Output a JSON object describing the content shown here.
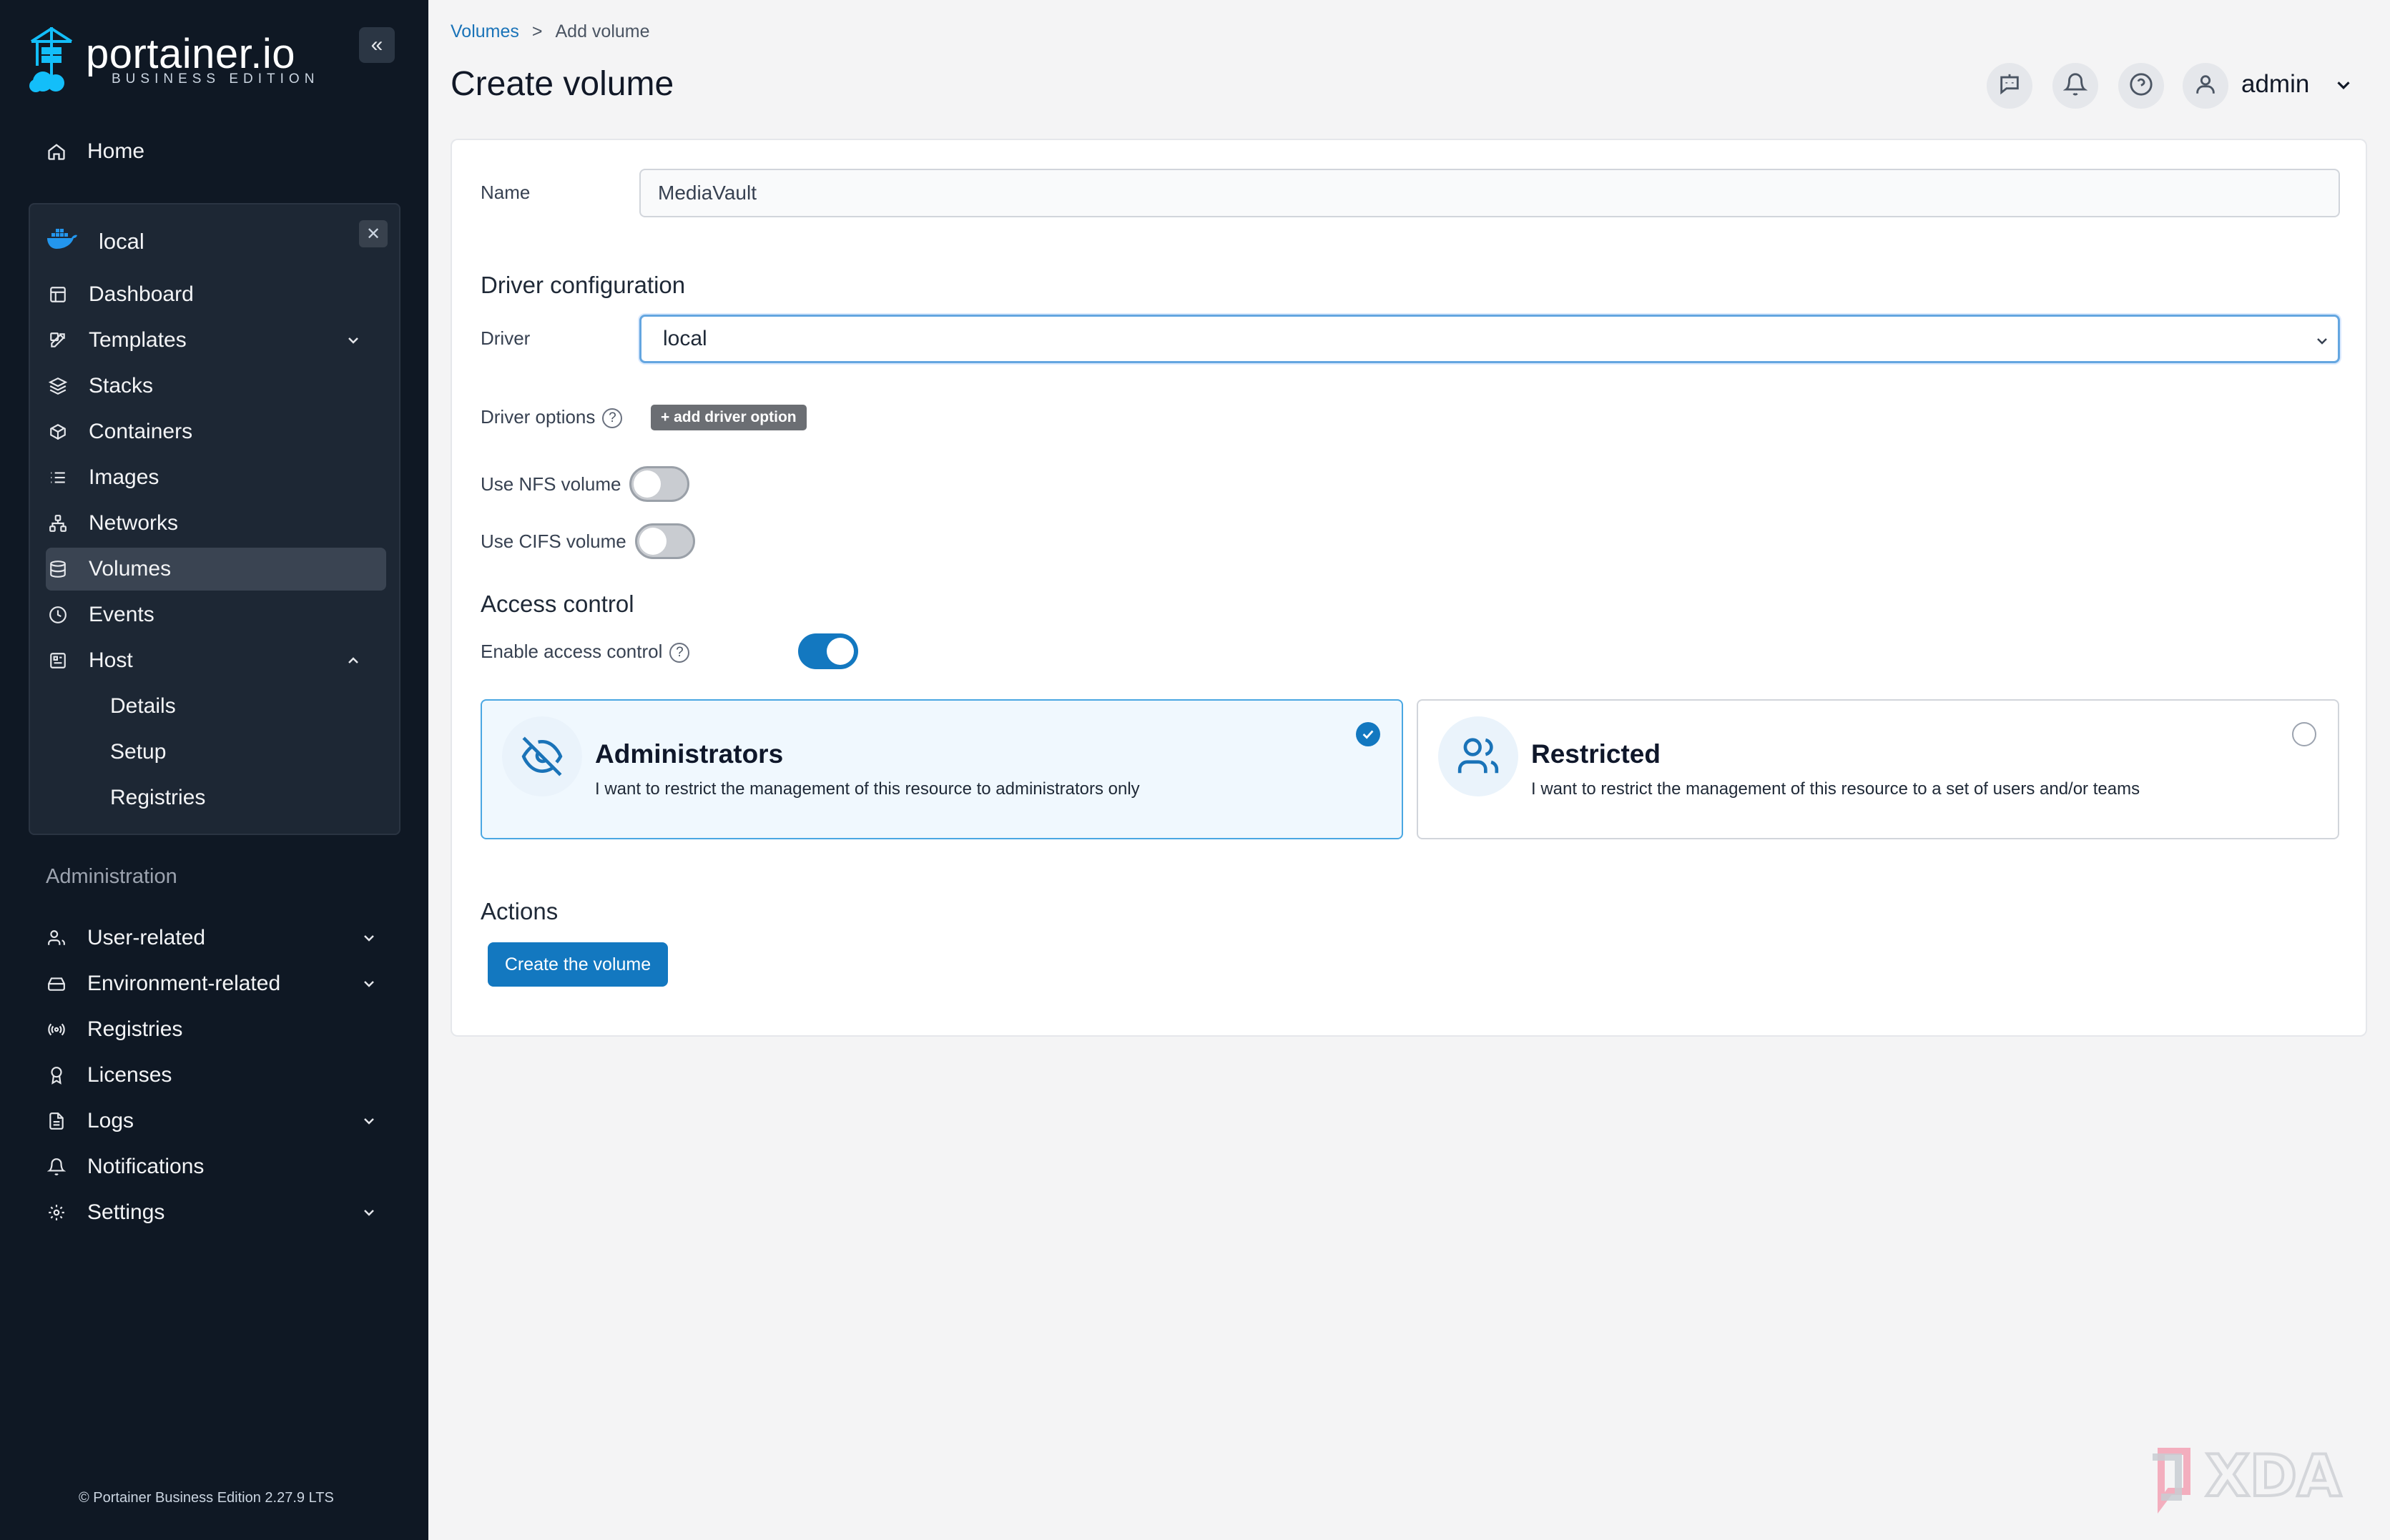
{
  "brand": {
    "name": "portainer.io",
    "edition": "BUSINESS EDITION",
    "footer": "© Portainer Business Edition 2.27.9 LTS"
  },
  "sidebar": {
    "home": "Home",
    "environment": {
      "name": "local",
      "items": [
        {
          "label": "Dashboard",
          "icon": "dashboard-icon"
        },
        {
          "label": "Templates",
          "icon": "templates-icon",
          "expandable": true
        },
        {
          "label": "Stacks",
          "icon": "stacks-icon"
        },
        {
          "label": "Containers",
          "icon": "containers-icon"
        },
        {
          "label": "Images",
          "icon": "images-icon"
        },
        {
          "label": "Networks",
          "icon": "networks-icon"
        },
        {
          "label": "Volumes",
          "icon": "volumes-icon",
          "active": true
        },
        {
          "label": "Events",
          "icon": "events-icon"
        },
        {
          "label": "Host",
          "icon": "host-icon",
          "expanded": true
        }
      ],
      "host_subitems": [
        "Details",
        "Setup",
        "Registries"
      ]
    },
    "admin_heading": "Administration",
    "admin_items": [
      {
        "label": "User-related",
        "icon": "user-icon",
        "expandable": true
      },
      {
        "label": "Environment-related",
        "icon": "environment-icon",
        "expandable": true
      },
      {
        "label": "Registries",
        "icon": "registries-icon"
      },
      {
        "label": "Licenses",
        "icon": "license-icon"
      },
      {
        "label": "Logs",
        "icon": "logs-icon",
        "expandable": true
      },
      {
        "label": "Notifications",
        "icon": "bell-icon"
      },
      {
        "label": "Settings",
        "icon": "gear-icon",
        "expandable": true
      }
    ]
  },
  "header": {
    "breadcrumb": {
      "link": "Volumes",
      "separator": ">",
      "current": "Add volume"
    },
    "title": "Create volume",
    "user": "admin"
  },
  "form": {
    "name_label": "Name",
    "name_value": "MediaVault",
    "driver_section": "Driver configuration",
    "driver_label": "Driver",
    "driver_value": "local",
    "driver_options_label": "Driver options",
    "add_driver_option": "+ add driver option",
    "nfs_label": "Use NFS volume",
    "nfs_enabled": false,
    "cifs_label": "Use CIFS volume",
    "cifs_enabled": false,
    "access_section": "Access control",
    "access_label": "Enable access control",
    "access_enabled": true,
    "access_options": [
      {
        "title": "Administrators",
        "description": "I want to restrict the management of this resource to administrators only",
        "selected": true
      },
      {
        "title": "Restricted",
        "description": "I want to restrict the management of this resource to a set of users and/or teams",
        "selected": false
      }
    ],
    "actions_section": "Actions",
    "submit_label": "Create the volume"
  },
  "colors": {
    "sidebar_bg": "#0f1824",
    "accent": "#1378c0",
    "selected_card_border": "#4aa7e2"
  },
  "watermark": "XDA"
}
